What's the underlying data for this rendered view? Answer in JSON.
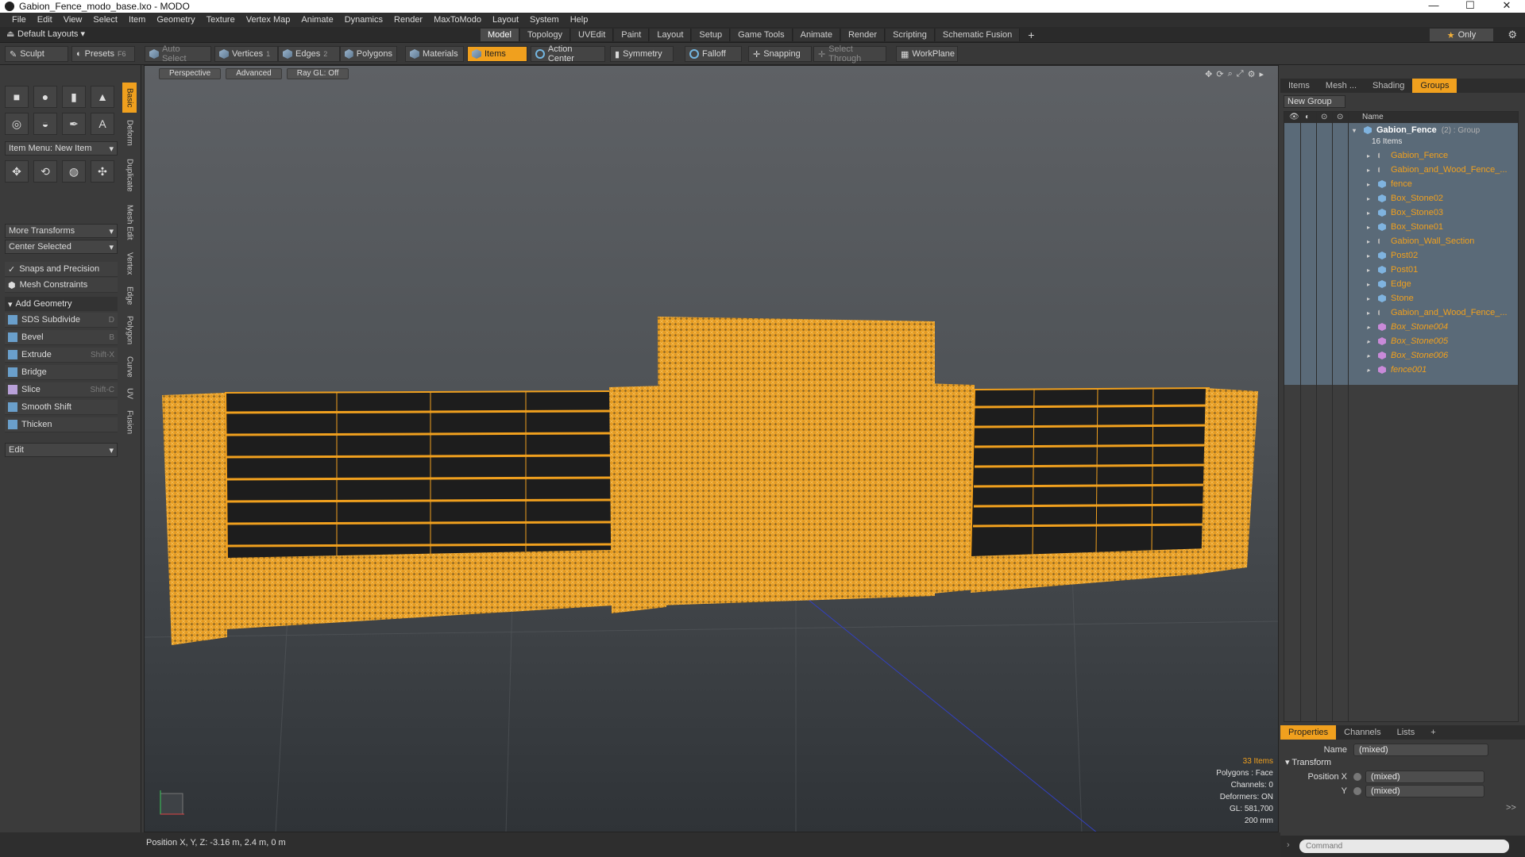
{
  "window": {
    "title": "Gabion_Fence_modo_base.lxo - MODO",
    "controls": [
      "—",
      "☐",
      "✕"
    ]
  },
  "menu": [
    "File",
    "Edit",
    "View",
    "Select",
    "Item",
    "Geometry",
    "Texture",
    "Vertex Map",
    "Animate",
    "Dynamics",
    "Render",
    "MaxToModo",
    "Layout",
    "System",
    "Help"
  ],
  "layouts": {
    "label": "Default Layouts ▾"
  },
  "tabs": [
    "Model",
    "Topology",
    "UVEdit",
    "Paint",
    "Layout",
    "Setup",
    "Game Tools",
    "Animate",
    "Render",
    "Scripting",
    "Schematic Fusion",
    "+"
  ],
  "active_tab": "Model",
  "only_label": "Only",
  "toolbar": {
    "sculpt": "Sculpt",
    "presets": "Presets",
    "presets_key": "F6",
    "auto_select": "Auto Select",
    "vertices": "Vertices",
    "vertices_count": "1",
    "edges": "Edges",
    "edges_count": "2",
    "polygons": "Polygons",
    "materials": "Materials",
    "items": "Items",
    "action_center": "Action Center",
    "symmetry": "Symmetry",
    "falloff": "Falloff",
    "snapping": "Snapping",
    "select_through": "Select Through",
    "workplane": "WorkPlane"
  },
  "toolbox": {
    "item_menu": "Item Menu: New Item",
    "more_transforms": "More Transforms",
    "center_selected": "Center Selected",
    "snaps": "Snaps and Precision",
    "mesh_constraints": "Mesh Constraints",
    "add_geometry": "Add Geometry",
    "tools": [
      {
        "label": "SDS Subdivide",
        "key": "D"
      },
      {
        "label": "Bevel",
        "key": "B"
      },
      {
        "label": "Extrude",
        "key": "Shift-X"
      },
      {
        "label": "Bridge",
        "key": ""
      },
      {
        "label": "Slice",
        "key": "Shift-C"
      },
      {
        "label": "Smooth Shift",
        "key": ""
      },
      {
        "label": "Thicken",
        "key": ""
      }
    ],
    "edit": "Edit",
    "vtabs": [
      "Basic",
      "Deform",
      "Duplicate",
      "Mesh Edit",
      "Vertex",
      "Edge",
      "Polygon",
      "Curve",
      "UV",
      "Fusion"
    ]
  },
  "viewport": {
    "buttons": [
      "Perspective",
      "Advanced",
      "Ray GL: Off"
    ],
    "stats": {
      "items": "33 Items",
      "polygons": "Polygons : Face",
      "channels": "Channels: 0",
      "deformers": "Deformers: ON",
      "gl": "GL: 581,700",
      "scale": "200 mm"
    }
  },
  "status": {
    "position": "Position X, Y, Z:   -3.16 m, 2.4 m, 0 m"
  },
  "right_panel": {
    "tabs": [
      "Items",
      "Mesh ...",
      "Shading",
      "Groups"
    ],
    "active_tab": "Groups",
    "new_group": "New Group",
    "column_name": "Name",
    "group": {
      "name": "Gabion_Fence",
      "suffix": "(2) : Group",
      "count": "16 Items"
    },
    "items": [
      {
        "name": "Gabion_Fence",
        "kind": "loc",
        "italic": false
      },
      {
        "name": "Gabion_and_Wood_Fence_...",
        "kind": "loc",
        "italic": false
      },
      {
        "name": "fence",
        "kind": "mesh",
        "italic": false
      },
      {
        "name": "Box_Stone02",
        "kind": "mesh",
        "italic": false
      },
      {
        "name": "Box_Stone03",
        "kind": "mesh",
        "italic": false
      },
      {
        "name": "Box_Stone01",
        "kind": "mesh",
        "italic": false
      },
      {
        "name": "Gabion_Wall_Section",
        "kind": "loc",
        "italic": false
      },
      {
        "name": "Post02",
        "kind": "mesh",
        "italic": false
      },
      {
        "name": "Post01",
        "kind": "mesh",
        "italic": false
      },
      {
        "name": "Edge",
        "kind": "mesh",
        "italic": false
      },
      {
        "name": "Stone",
        "kind": "mesh",
        "italic": false
      },
      {
        "name": "Gabion_and_Wood_Fence_...",
        "kind": "loc",
        "italic": false
      },
      {
        "name": "Box_Stone004",
        "kind": "inst",
        "italic": true
      },
      {
        "name": "Box_Stone005",
        "kind": "inst",
        "italic": true
      },
      {
        "name": "Box_Stone006",
        "kind": "inst",
        "italic": true
      },
      {
        "name": "fence001",
        "kind": "inst",
        "italic": true
      }
    ]
  },
  "properties": {
    "tabs": [
      "Properties",
      "Channels",
      "Lists",
      "+"
    ],
    "name_label": "Name",
    "name_value": "(mixed)",
    "transform": "Transform",
    "pos_x_label": "Position X",
    "pos_x_value": "(mixed)",
    "pos_y_label": "Y",
    "pos_y_value": "(mixed)",
    "more": ">>"
  },
  "command": {
    "placeholder": "Command"
  },
  "colors": {
    "accent": "#f0a01e",
    "viewport_top": "#5e6165",
    "viewport_bottom": "#2f3337",
    "selection": "#5a6a78"
  }
}
